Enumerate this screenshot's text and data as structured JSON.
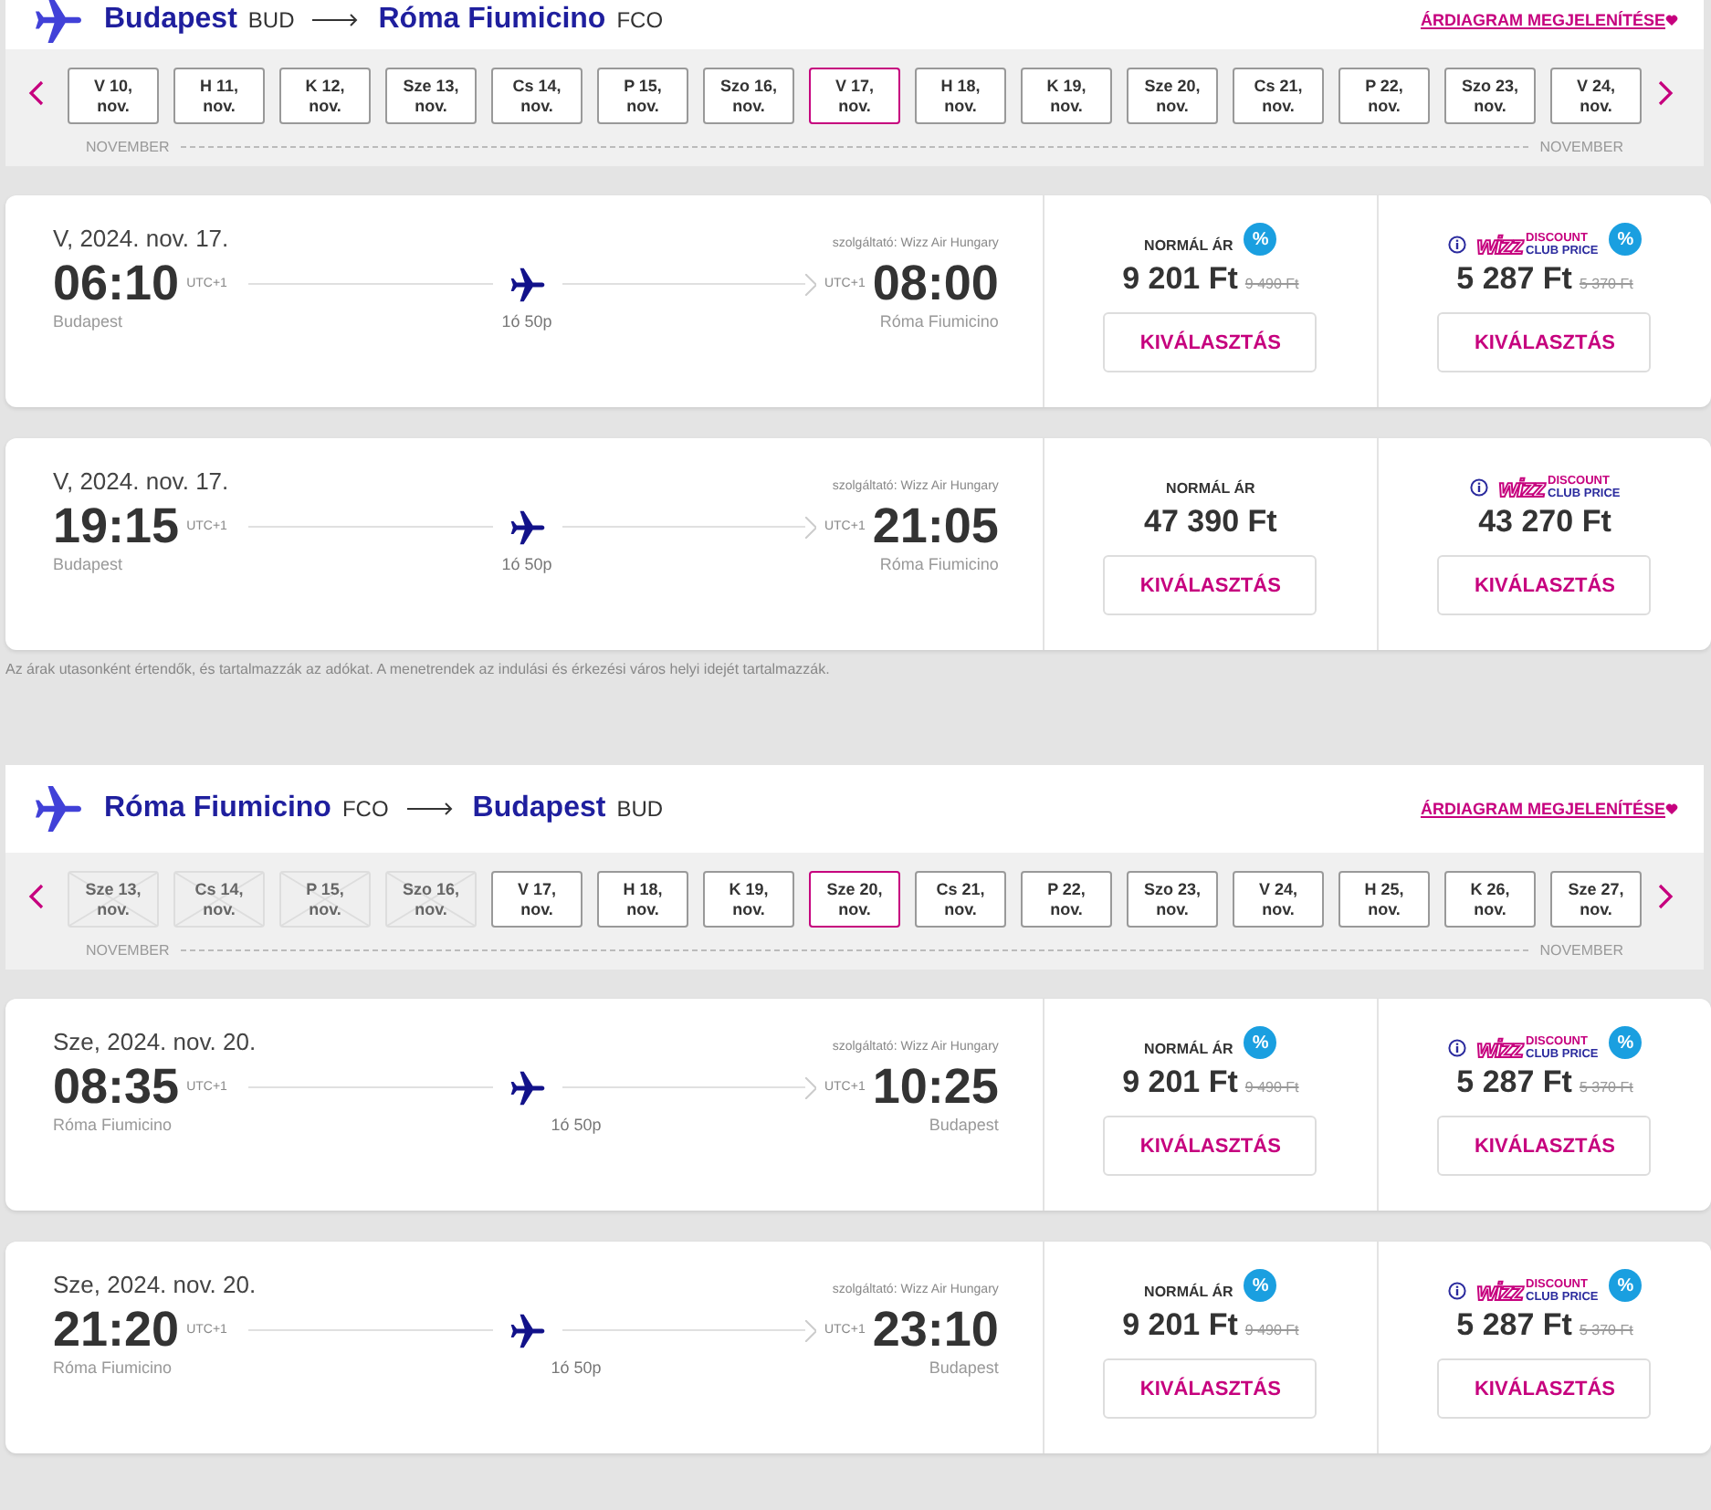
{
  "legs": [
    {
      "from_city": "Budapest",
      "from_code": "BUD",
      "to_city": "Róma Fiumicino",
      "to_code": "FCO",
      "chart_link": "ÁRDIAGRAM MEGJELENÍTÉSE",
      "month_start": "NOVEMBER",
      "month_end": "NOVEMBER",
      "dates": [
        {
          "label": "V 10,\nnov.",
          "selected": false,
          "disabled": false
        },
        {
          "label": "H 11,\nnov.",
          "selected": false,
          "disabled": false
        },
        {
          "label": "K 12,\nnov.",
          "selected": false,
          "disabled": false
        },
        {
          "label": "Sze 13,\nnov.",
          "selected": false,
          "disabled": false
        },
        {
          "label": "Cs 14,\nnov.",
          "selected": false,
          "disabled": false
        },
        {
          "label": "P 15,\nnov.",
          "selected": false,
          "disabled": false
        },
        {
          "label": "Szo 16,\nnov.",
          "selected": false,
          "disabled": false
        },
        {
          "label": "V 17,\nnov.",
          "selected": true,
          "disabled": false
        },
        {
          "label": "H 18,\nnov.",
          "selected": false,
          "disabled": false
        },
        {
          "label": "K 19,\nnov.",
          "selected": false,
          "disabled": false
        },
        {
          "label": "Sze 20,\nnov.",
          "selected": false,
          "disabled": false
        },
        {
          "label": "Cs 21,\nnov.",
          "selected": false,
          "disabled": false
        },
        {
          "label": "P 22,\nnov.",
          "selected": false,
          "disabled": false
        },
        {
          "label": "Szo 23,\nnov.",
          "selected": false,
          "disabled": false
        },
        {
          "label": "V 24,\nnov.",
          "selected": false,
          "disabled": false
        }
      ],
      "flights": [
        {
          "date": "V, 2024. nov. 17.",
          "operator": "szolgáltató: Wizz Air Hungary",
          "dep_time": "06:10",
          "dep_tz": "UTC+1",
          "arr_time": "08:00",
          "arr_tz": "UTC+1",
          "duration": "1ó 50p",
          "from": "Budapest",
          "to": "Róma Fiumicino",
          "fares": [
            {
              "kind": "normal",
              "label": "NORMÁL ÁR",
              "price": "9 201 Ft",
              "old_price": "9 490 Ft",
              "badge": "%",
              "button": "KIVÁLASZTÁS"
            },
            {
              "kind": "club",
              "logo": "wizz",
              "logo_top": "DISCOUNT",
              "logo_bottom": "CLUB PRICE",
              "price": "5 287 Ft",
              "old_price": "5 370 Ft",
              "badge": "%",
              "button": "KIVÁLASZTÁS"
            }
          ]
        },
        {
          "date": "V, 2024. nov. 17.",
          "operator": "szolgáltató: Wizz Air Hungary",
          "dep_time": "19:15",
          "dep_tz": "UTC+1",
          "arr_time": "21:05",
          "arr_tz": "UTC+1",
          "duration": "1ó 50p",
          "from": "Budapest",
          "to": "Róma Fiumicino",
          "fares": [
            {
              "kind": "normal",
              "label": "NORMÁL ÁR",
              "price": "47 390 Ft",
              "button": "KIVÁLASZTÁS"
            },
            {
              "kind": "club",
              "logo": "wizz",
              "logo_top": "DISCOUNT",
              "logo_bottom": "CLUB PRICE",
              "price": "43 270 Ft",
              "button": "KIVÁLASZTÁS"
            }
          ]
        }
      ],
      "note": "Az árak utasonként értendők, és tartalmazzák az adókat. A menetrendek az indulási és érkezési város helyi idejét tartalmazzák."
    },
    {
      "from_city": "Róma Fiumicino",
      "from_code": "FCO",
      "to_city": "Budapest",
      "to_code": "BUD",
      "chart_link": "ÁRDIAGRAM MEGJELENÍTÉSE",
      "month_start": "NOVEMBER",
      "month_end": "NOVEMBER",
      "dates": [
        {
          "label": "Sze 13,\nnov.",
          "selected": false,
          "disabled": true
        },
        {
          "label": "Cs 14,\nnov.",
          "selected": false,
          "disabled": true
        },
        {
          "label": "P 15,\nnov.",
          "selected": false,
          "disabled": true
        },
        {
          "label": "Szo 16,\nnov.",
          "selected": false,
          "disabled": true
        },
        {
          "label": "V 17,\nnov.",
          "selected": false,
          "disabled": false
        },
        {
          "label": "H 18,\nnov.",
          "selected": false,
          "disabled": false
        },
        {
          "label": "K 19,\nnov.",
          "selected": false,
          "disabled": false
        },
        {
          "label": "Sze 20,\nnov.",
          "selected": true,
          "disabled": false
        },
        {
          "label": "Cs 21,\nnov.",
          "selected": false,
          "disabled": false
        },
        {
          "label": "P 22,\nnov.",
          "selected": false,
          "disabled": false
        },
        {
          "label": "Szo 23,\nnov.",
          "selected": false,
          "disabled": false
        },
        {
          "label": "V 24,\nnov.",
          "selected": false,
          "disabled": false
        },
        {
          "label": "H 25,\nnov.",
          "selected": false,
          "disabled": false
        },
        {
          "label": "K 26,\nnov.",
          "selected": false,
          "disabled": false
        },
        {
          "label": "Sze 27,\nnov.",
          "selected": false,
          "disabled": false
        }
      ],
      "flights": [
        {
          "date": "Sze, 2024. nov. 20.",
          "operator": "szolgáltató: Wizz Air Hungary",
          "dep_time": "08:35",
          "dep_tz": "UTC+1",
          "arr_time": "10:25",
          "arr_tz": "UTC+1",
          "duration": "1ó 50p",
          "from": "Róma Fiumicino",
          "to": "Budapest",
          "fares": [
            {
              "kind": "normal",
              "label": "NORMÁL ÁR",
              "price": "9 201 Ft",
              "old_price": "9 490 Ft",
              "badge": "%",
              "button": "KIVÁLASZTÁS"
            },
            {
              "kind": "club",
              "logo": "wizz",
              "logo_top": "DISCOUNT",
              "logo_bottom": "CLUB PRICE",
              "price": "5 287 Ft",
              "old_price": "5 370 Ft",
              "badge": "%",
              "button": "KIVÁLASZTÁS"
            }
          ]
        },
        {
          "date": "Sze, 2024. nov. 20.",
          "operator": "szolgáltató: Wizz Air Hungary",
          "dep_time": "21:20",
          "dep_tz": "UTC+1",
          "arr_time": "23:10",
          "arr_tz": "UTC+1",
          "duration": "1ó 50p",
          "from": "Róma Fiumicino",
          "to": "Budapest",
          "fares": [
            {
              "kind": "normal",
              "label": "NORMÁL ÁR",
              "price": "9 201 Ft",
              "old_price": "9 490 Ft",
              "badge": "%",
              "button": "KIVÁLASZTÁS"
            },
            {
              "kind": "club",
              "logo": "wizz",
              "logo_top": "DISCOUNT",
              "logo_bottom": "CLUB PRICE",
              "price": "5 287 Ft",
              "old_price": "5 370 Ft",
              "badge": "%",
              "button": "KIVÁLASZTÁS"
            }
          ]
        }
      ]
    }
  ]
}
